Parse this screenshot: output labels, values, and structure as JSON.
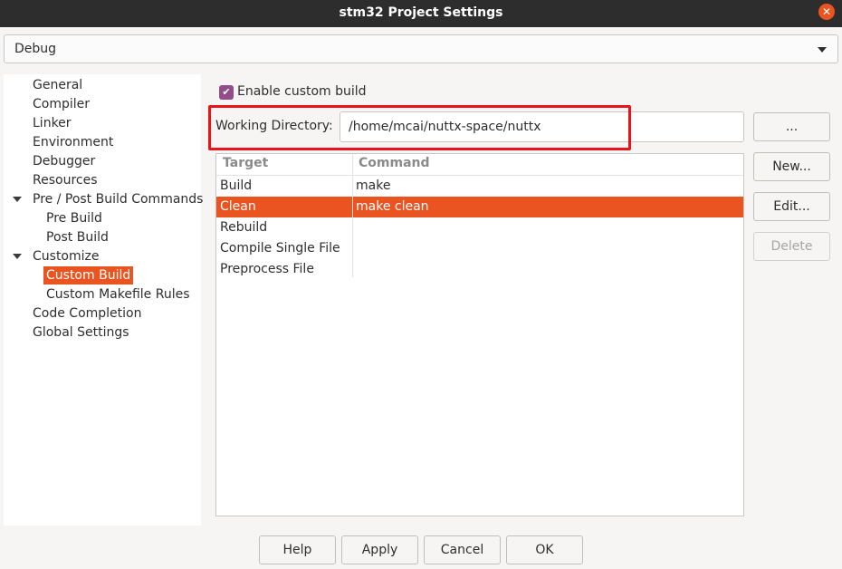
{
  "window": {
    "title": "stm32 Project Settings"
  },
  "config": {
    "selected": "Debug"
  },
  "sidebar": {
    "items": [
      {
        "label": "General"
      },
      {
        "label": "Compiler"
      },
      {
        "label": "Linker"
      },
      {
        "label": "Environment"
      },
      {
        "label": "Debugger"
      },
      {
        "label": "Resources"
      },
      {
        "label": "Pre / Post Build Commands"
      },
      {
        "label": "Pre Build"
      },
      {
        "label": "Post Build"
      },
      {
        "label": "Customize"
      },
      {
        "label": "Custom Build"
      },
      {
        "label": "Custom Makefile Rules"
      },
      {
        "label": "Code Completion"
      },
      {
        "label": "Global Settings"
      }
    ]
  },
  "custom_build": {
    "enable_label": "Enable custom build",
    "enabled": true,
    "working_dir_label": "Working Directory:",
    "working_dir_value": "/home/mcai/nuttx-space/nuttx",
    "browse_label": "..."
  },
  "table": {
    "headers": [
      "Target",
      "Command"
    ],
    "rows": [
      {
        "target": "Build",
        "command": "make"
      },
      {
        "target": "Clean",
        "command": "make clean"
      },
      {
        "target": "Rebuild",
        "command": ""
      },
      {
        "target": "Compile Single File",
        "command": ""
      },
      {
        "target": "Preprocess File",
        "command": ""
      }
    ],
    "selected_row": 1
  },
  "buttons": {
    "new": "New...",
    "edit": "Edit...",
    "delete": "Delete",
    "help": "Help",
    "apply": "Apply",
    "cancel": "Cancel",
    "ok": "OK"
  },
  "colors": {
    "accent": "#e95420",
    "checkbox": "#924d8b",
    "highlight": "#e8141c",
    "titlebar": "#2d2d2d"
  },
  "icons": {
    "close": "close-icon",
    "dropdown": "chevron-down-icon",
    "expand": "triangle-down-icon",
    "check": "check-icon"
  }
}
